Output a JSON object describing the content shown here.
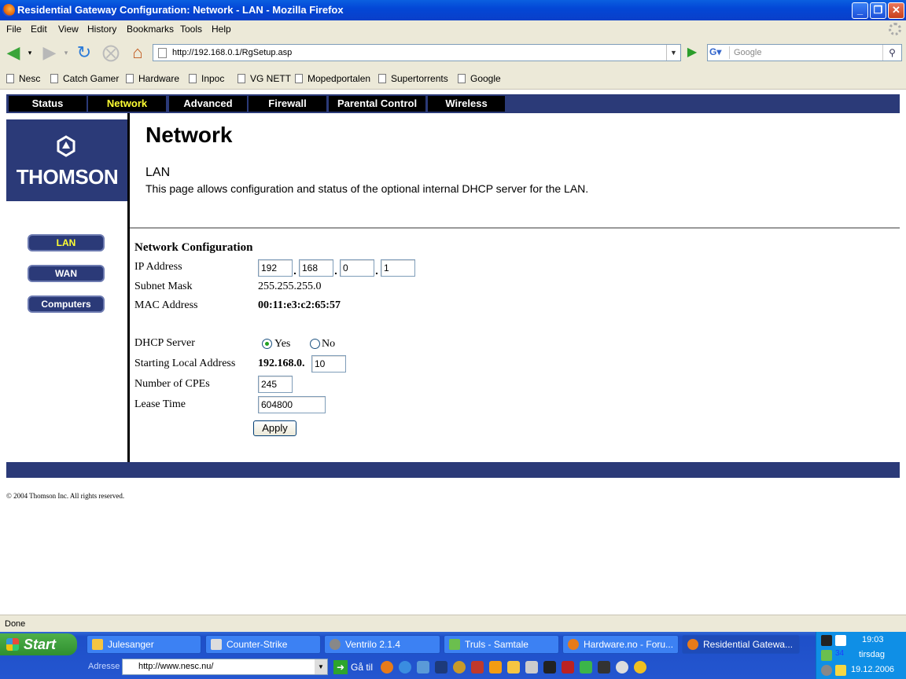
{
  "window": {
    "title": "Residential Gateway Configuration: Network - LAN - Mozilla Firefox",
    "minimize": "_",
    "maximize": "❐",
    "close": "✕"
  },
  "menu": [
    "File",
    "Edit",
    "View",
    "History",
    "Bookmarks",
    "Tools",
    "Help"
  ],
  "toolbar": {
    "url": "http://192.168.0.1/RgSetup.asp",
    "search_placeholder": "Google",
    "search_engine": "G"
  },
  "bookmarks": [
    "Nesc",
    "Catch Gamer",
    "Hardware",
    "Inpoc",
    "VG NETT",
    "Mopedportalen",
    "Supertorrents",
    "Google"
  ],
  "router": {
    "tabs": [
      "Status",
      "Network",
      "Advanced",
      "Firewall",
      "Parental Control",
      "Wireless"
    ],
    "active_tab": "Network",
    "logo_text": "THOMSON",
    "sidebar": [
      "LAN",
      "WAN",
      "Computers"
    ],
    "active_sidebar": "LAN",
    "page_title": "Network",
    "section_title": "LAN",
    "description": "This page allows configuration and status of the optional internal DHCP server for the LAN.",
    "form": {
      "heading": "Network Configuration",
      "ip_label": "IP Address",
      "ip": [
        "192",
        "168",
        "0",
        "1"
      ],
      "subnet_label": "Subnet Mask",
      "subnet": "255.255.255.0",
      "mac_label": "MAC Address",
      "mac": "00:11:e3:c2:65:57",
      "dhcp_label": "DHCP Server",
      "dhcp_yes": "Yes",
      "dhcp_no": "No",
      "dhcp_selected": "Yes",
      "start_label": "Starting Local Address",
      "start_prefix": "192.168.0.",
      "start_value": "10",
      "cpe_label": "Number of CPEs",
      "cpe_value": "245",
      "lease_label": "Lease Time",
      "lease_value": "604800",
      "apply": "Apply"
    },
    "copyright": "© 2004  Thomson Inc.   All rights reserved."
  },
  "status": "Done",
  "taskbar": {
    "start": "Start",
    "tasks": [
      "Julesanger",
      "Counter-Strike",
      "Ventrilo 2.1.4",
      "Truls - Samtale",
      "Hardware.no - Foru...",
      "Residential Gatewa..."
    ],
    "address_label": "Adresse",
    "address": "http://www.nesc.nu/",
    "go_label": "Gå til",
    "clock": "19:03",
    "day": "tirsdag",
    "date": "19.12.2006",
    "tray_number": "34"
  },
  "colors": {
    "router_blue": "#2b3a78",
    "active_tab": "#ffff33",
    "xp_blue": "#0a5fe0"
  }
}
